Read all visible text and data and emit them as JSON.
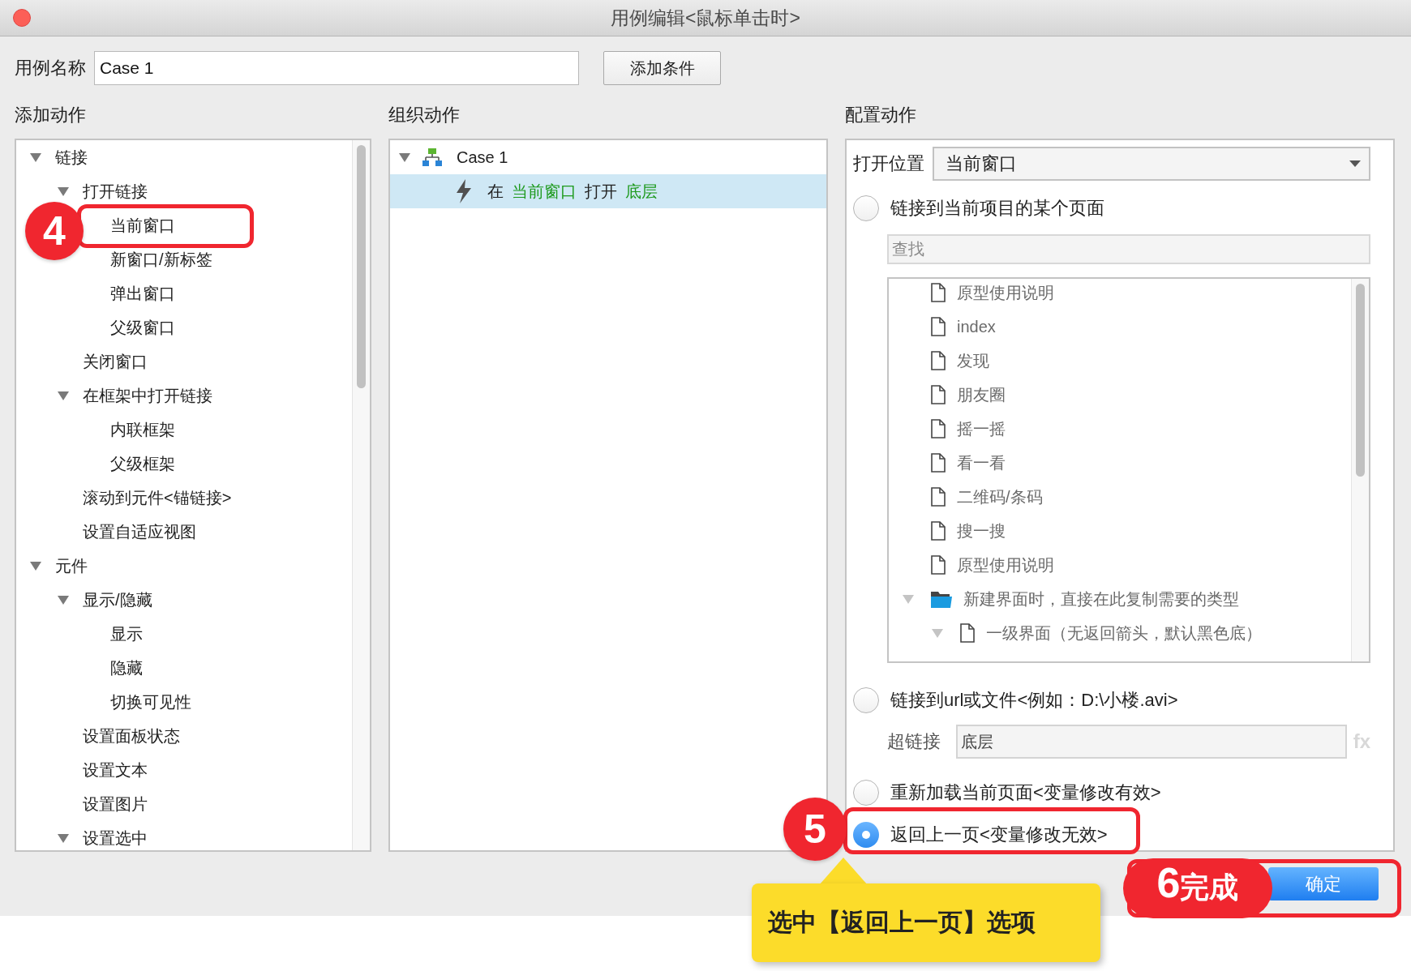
{
  "window": {
    "title": "用例编辑<鼠标单击时>"
  },
  "case_name": {
    "label": "用例名称",
    "value": "Case 1"
  },
  "add_condition_button": "添加条件",
  "add_actions": {
    "heading": "添加动作",
    "tree": [
      {
        "label": "链接",
        "expanded": true,
        "children": [
          {
            "label": "打开链接",
            "expanded": true,
            "children": [
              {
                "label": "当前窗口"
              },
              {
                "label": "新窗口/新标签"
              },
              {
                "label": "弹出窗口"
              },
              {
                "label": "父级窗口"
              }
            ]
          },
          {
            "label": "关闭窗口"
          },
          {
            "label": "在框架中打开链接",
            "expanded": true,
            "children": [
              {
                "label": "内联框架"
              },
              {
                "label": "父级框架"
              }
            ]
          },
          {
            "label": "滚动到元件<锚链接>"
          },
          {
            "label": "设置自适应视图"
          }
        ]
      },
      {
        "label": "元件",
        "expanded": true,
        "children": [
          {
            "label": "显示/隐藏",
            "expanded": true,
            "children": [
              {
                "label": "显示"
              },
              {
                "label": "隐藏"
              },
              {
                "label": "切换可见性"
              }
            ]
          },
          {
            "label": "设置面板状态"
          },
          {
            "label": "设置文本"
          },
          {
            "label": "设置图片"
          },
          {
            "label": "设置选中",
            "expanded": true
          }
        ]
      }
    ]
  },
  "organize_actions": {
    "heading": "组织动作",
    "cases": [
      {
        "label": "Case 1",
        "expanded": true,
        "actions": [
          {
            "selected": true,
            "parts": [
              {
                "text": "在",
                "highlight": false
              },
              {
                "text": "当前窗口",
                "highlight": true
              },
              {
                "text": "打开",
                "highlight": false
              },
              {
                "text": "底层",
                "highlight": true
              }
            ]
          }
        ]
      }
    ]
  },
  "configure_action": {
    "heading": "配置动作",
    "open_in": {
      "label": "打开位置",
      "value": "当前窗口"
    },
    "options": [
      {
        "kind": "page",
        "label": "链接到当前项目的某个页面",
        "selected": false,
        "search": {
          "placeholder": "查找"
        },
        "pages": [
          {
            "kind": "page",
            "label": "原型使用说明"
          },
          {
            "kind": "page",
            "label": "index"
          },
          {
            "kind": "page",
            "label": "发现"
          },
          {
            "kind": "page",
            "label": "朋友圈"
          },
          {
            "kind": "page",
            "label": "摇一摇"
          },
          {
            "kind": "page",
            "label": "看一看"
          },
          {
            "kind": "page",
            "label": "二维码/条码"
          },
          {
            "kind": "page",
            "label": "搜一搜"
          },
          {
            "kind": "page",
            "label": "原型使用说明"
          },
          {
            "kind": "folder",
            "label": "新建界面时，直接在此复制需要的类型",
            "expanded": true,
            "children": [
              {
                "kind": "page",
                "label": "一级界面（无返回箭头，默认黑色底）",
                "expanded": true
              }
            ]
          }
        ]
      },
      {
        "kind": "url",
        "label": "链接到url或文件<例如：D:\\小楼.avi>",
        "selected": false,
        "hyperlink": {
          "label": "超链接",
          "value": "底层",
          "fx": "fx"
        }
      },
      {
        "kind": "plain",
        "label": "重新加载当前页面<变量修改有效>",
        "selected": false
      },
      {
        "kind": "plain",
        "label": "返回上一页<变量修改无效>",
        "selected": true
      }
    ]
  },
  "buttons": [
    {
      "label": "确定",
      "kind": "primary"
    }
  ],
  "annotations": [
    {
      "number": "4"
    },
    {
      "number": "5",
      "callout": "选中【返回上一页】选项"
    },
    {
      "number": "6",
      "label": "完成"
    }
  ]
}
